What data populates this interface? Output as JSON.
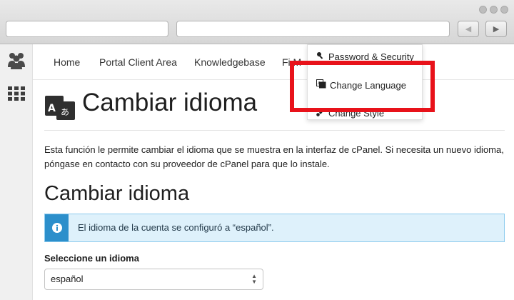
{
  "nav": {
    "items": [
      "Home",
      "Portal Client Area",
      "Knowledgebase",
      "Fi M"
    ]
  },
  "dropdown": {
    "items": [
      "Password & Security",
      "Change Language",
      "Change Style"
    ]
  },
  "page": {
    "title": "Cambiar idioma",
    "description": "Esta función le permite cambiar el idioma que se muestra en la interfaz de cPanel. Si necesita un nuevo idioma, póngase en contacto con su proveedor de cPanel para que lo instale.",
    "section_title": "Cambiar idioma",
    "alert_text": "El idioma de la cuenta se configuró a “español”.",
    "select_label": "Seleccione un idioma",
    "select_value": "español",
    "page_icon_glyphs": "A あ"
  },
  "icons": {
    "sidebar": [
      "users-icon",
      "grid-icon"
    ],
    "dropdown": [
      "key-icon",
      "language-icon",
      "brush-icon"
    ],
    "alert": "info-icon",
    "browser": [
      "back-arrow-icon",
      "forward-arrow-icon"
    ]
  },
  "colors": {
    "highlight": "#e8121a",
    "alert_bg": "#def1fb",
    "alert_accent": "#2c8fcb"
  }
}
